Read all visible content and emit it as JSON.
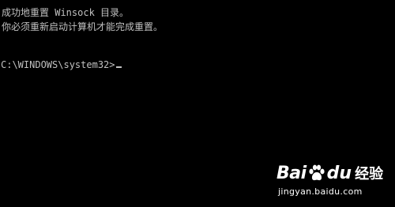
{
  "console": {
    "line1": "成功地重置 Winsock 目录。",
    "line2": "你必须重新启动计算机才能完成重置。",
    "prompt": "C:\\WINDOWS\\system32>"
  },
  "watermark": {
    "brand_left": "Bai",
    "brand_right": "du",
    "product": "经验",
    "url": "jingyan.baidu.com"
  },
  "colors": {
    "background": "#000000",
    "text": "#c0c0c0",
    "watermark": "#ffffff"
  }
}
